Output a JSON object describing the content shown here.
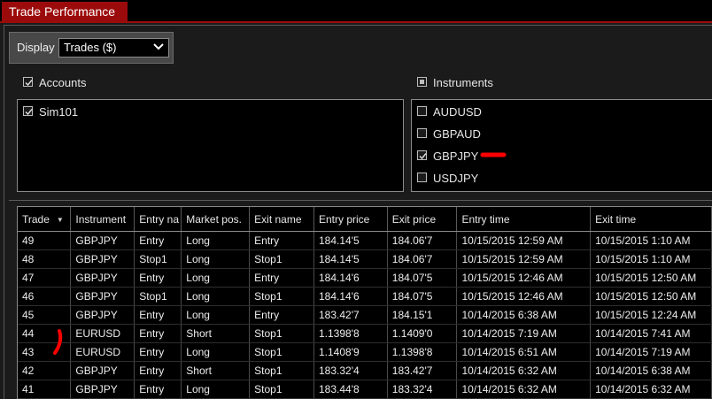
{
  "window": {
    "title": "Trade Performance"
  },
  "display": {
    "label": "Display",
    "selected": "Trades ($)"
  },
  "accounts": {
    "label": "Accounts",
    "checked": true,
    "items": [
      {
        "label": "Sim101",
        "checked": true
      }
    ]
  },
  "instruments": {
    "label": "Instruments",
    "state": "partial",
    "items": [
      {
        "label": "AUDUSD",
        "checked": false
      },
      {
        "label": "GBPAUD",
        "checked": false
      },
      {
        "label": "GBPJPY",
        "checked": true
      },
      {
        "label": "USDJPY",
        "checked": false
      }
    ]
  },
  "table": {
    "sort_column": "Trade",
    "sort_direction": "descending",
    "columns": [
      "Trade",
      "Instrument",
      "Entry na",
      "Market pos.",
      "Exit name",
      "Entry price",
      "Exit price",
      "Entry time",
      "Exit time"
    ],
    "rows": [
      [
        "49",
        "GBPJPY",
        "Entry",
        "Long",
        "Entry",
        "184.14'5",
        "184.06'7",
        "10/15/2015 12:59 AM",
        "10/15/2015 1:10 AM"
      ],
      [
        "48",
        "GBPJPY",
        "Stop1",
        "Long",
        "Stop1",
        "184.14'5",
        "184.06'7",
        "10/15/2015 12:59 AM",
        "10/15/2015 1:10 AM"
      ],
      [
        "47",
        "GBPJPY",
        "Entry",
        "Long",
        "Entry",
        "184.14'6",
        "184.07'5",
        "10/15/2015 12:46 AM",
        "10/15/2015 12:50 AM"
      ],
      [
        "46",
        "GBPJPY",
        "Stop1",
        "Long",
        "Stop1",
        "184.14'6",
        "184.07'5",
        "10/15/2015 12:46 AM",
        "10/15/2015 12:50 AM"
      ],
      [
        "45",
        "GBPJPY",
        "Entry",
        "Long",
        "Entry",
        "183.42'7",
        "184.15'1",
        "10/14/2015 6:38 AM",
        "10/15/2015 12:24 AM"
      ],
      [
        "44",
        "EURUSD",
        "Entry",
        "Short",
        "Stop1",
        "1.1398'8",
        "1.1409'0",
        "10/14/2015 7:19 AM",
        "10/14/2015 7:41 AM"
      ],
      [
        "43",
        "EURUSD",
        "Entry",
        "Long",
        "Stop1",
        "1.1408'9",
        "1.1398'8",
        "10/14/2015 6:51 AM",
        "10/14/2015 7:19 AM"
      ],
      [
        "42",
        "GBPJPY",
        "Entry",
        "Short",
        "Stop1",
        "183.32'4",
        "183.42'7",
        "10/14/2015 6:32 AM",
        "10/14/2015 6:38 AM"
      ],
      [
        "41",
        "GBPJPY",
        "Entry",
        "Long",
        "Stop1",
        "183.44'8",
        "183.32'4",
        "10/14/2015 6:32 AM",
        "10/14/2015 6:32 AM"
      ]
    ]
  },
  "colors": {
    "title_tab": "#9c0b0b",
    "background": "#1b1b1b",
    "panel": "#000000",
    "annotation": "#ff0000"
  },
  "icons": {
    "dropdown": "chevron-down-icon",
    "sort": "sort-descending-icon",
    "check": "check-icon"
  }
}
